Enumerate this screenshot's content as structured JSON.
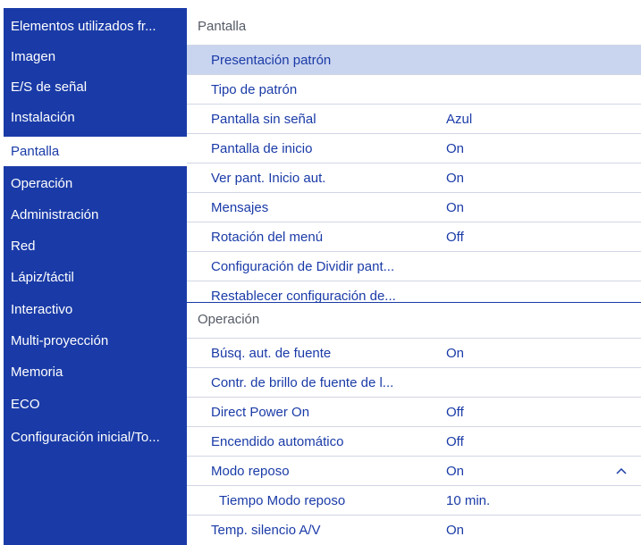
{
  "sidebar": {
    "items": [
      {
        "label": "Elementos utilizados fr..."
      },
      {
        "label": "Imagen"
      },
      {
        "label": "E/S de señal"
      },
      {
        "label": "Instalación"
      },
      {
        "label": "Pantalla",
        "selected": true
      },
      {
        "label": "Operación"
      },
      {
        "label": "Administración"
      },
      {
        "label": "Red"
      },
      {
        "label": "Lápiz/táctil"
      },
      {
        "label": "Interactivo"
      },
      {
        "label": "Multi-proyección"
      },
      {
        "label": "Memoria"
      },
      {
        "label": "ECO"
      },
      {
        "label": "Configuración inicial/To..."
      }
    ]
  },
  "main": {
    "pantalla_header": "Pantalla",
    "pantalla_rows": [
      {
        "label": "Presentación patrón",
        "value": ""
      },
      {
        "label": "Tipo de patrón",
        "value": ""
      },
      {
        "label": "Pantalla sin señal",
        "value": "Azul"
      },
      {
        "label": "Pantalla de inicio",
        "value": "On"
      },
      {
        "label": "Ver pant. Inicio aut.",
        "value": "On"
      },
      {
        "label": "Mensajes",
        "value": "On"
      },
      {
        "label": "Rotación del menú",
        "value": "Off"
      },
      {
        "label": "Configuración de Dividir pant...",
        "value": ""
      },
      {
        "label": "Restablecer configuración de...",
        "value": ""
      }
    ],
    "operacion_header": "Operación",
    "operacion_rows": [
      {
        "label": "Búsq. aut. de fuente",
        "value": "On"
      },
      {
        "label": "Contr. de brillo de fuente de l...",
        "value": ""
      },
      {
        "label": "Direct Power On",
        "value": "Off"
      },
      {
        "label": "Encendido automático",
        "value": "Off"
      },
      {
        "label": "Modo reposo",
        "value": "On"
      },
      {
        "label": "Tiempo Modo reposo",
        "value": "10 min."
      },
      {
        "label": "Temp. silencio A/V",
        "value": "On"
      }
    ],
    "collapse_icon": "chevron-up-icon",
    "colors": {
      "accent": "#1a3ba7",
      "highlight": "#c9d4ef"
    }
  }
}
